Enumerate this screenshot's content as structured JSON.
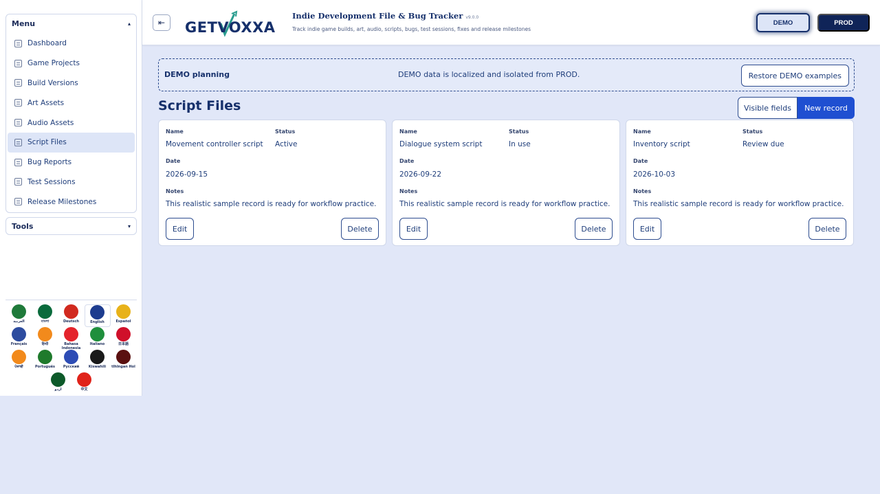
{
  "sidebar": {
    "menu_title": "Menu",
    "items": [
      {
        "label": "Dashboard"
      },
      {
        "label": "Game Projects"
      },
      {
        "label": "Build Versions"
      },
      {
        "label": "Art Assets"
      },
      {
        "label": "Audio Assets"
      },
      {
        "label": "Script Files"
      },
      {
        "label": "Bug Reports"
      },
      {
        "label": "Test Sessions"
      },
      {
        "label": "Release Milestones"
      }
    ],
    "tools_title": "Tools"
  },
  "languages": [
    {
      "label": "العربية",
      "color": "#1f7a3a"
    },
    {
      "label": "বাংলা",
      "color": "#0a6b3c"
    },
    {
      "label": "Deutsch",
      "color": "#d12a1f"
    },
    {
      "label": "English",
      "color": "#1d3c8f"
    },
    {
      "label": "Español",
      "color": "#e8b21a"
    },
    {
      "label": "Français",
      "color": "#2d4c9f"
    },
    {
      "label": "हिन्दी",
      "color": "#f28a1c"
    },
    {
      "label": "Bahasa Indonesia",
      "color": "#e4242c"
    },
    {
      "label": "Italiano",
      "color": "#1f8f3c"
    },
    {
      "label": "日本語",
      "color": "#d0102a"
    },
    {
      "label": "ਪੰਜਾਬੀ",
      "color": "#f28a1c"
    },
    {
      "label": "Português",
      "color": "#1f7a2c"
    },
    {
      "label": "Русский",
      "color": "#2d4cb5"
    },
    {
      "label": "Kiswahili",
      "color": "#1a1a1a"
    },
    {
      "label": "tlhIngan Hol",
      "color": "#5a1010"
    },
    {
      "label": "اردو",
      "color": "#0d5a2a"
    },
    {
      "label": "中文",
      "color": "#e0231a"
    }
  ],
  "header": {
    "collapse_icon": "collapse-sidebar-icon",
    "logo_text": "GETVOXXA",
    "app_title": "Indie Development File & Bug Tracker",
    "version": "v9.0.0",
    "subtitle": "Track indie game builds, art, audio, scripts, bugs, test sessions, fixes and release milestones",
    "env_demo": "DEMO",
    "env_prod": "PROD"
  },
  "banner": {
    "title": "DEMO planning",
    "message": "DEMO data is localized and isolated from PROD.",
    "restore_label": "Restore DEMO examples"
  },
  "main": {
    "title": "Script Files",
    "visible_fields_label": "Visible fields",
    "new_record_label": "New record",
    "field_labels": {
      "name": "Name",
      "status": "Status",
      "date": "Date",
      "notes": "Notes"
    },
    "edit_label": "Edit",
    "delete_label": "Delete",
    "records": [
      {
        "name": "Movement controller script",
        "status": "Active",
        "date": "2026-09-15",
        "notes": "This realistic sample record is ready for workflow practice."
      },
      {
        "name": "Dialogue system script",
        "status": "In use",
        "date": "2026-09-22",
        "notes": "This realistic sample record is ready for workflow practice."
      },
      {
        "name": "Inventory script",
        "status": "Review due",
        "date": "2026-10-03",
        "notes": "This realistic sample record is ready for workflow practice."
      }
    ]
  },
  "colors": {
    "brand_navy": "#16306b",
    "primary_blue": "#1f4fd1",
    "background": "#e1e7f8"
  }
}
